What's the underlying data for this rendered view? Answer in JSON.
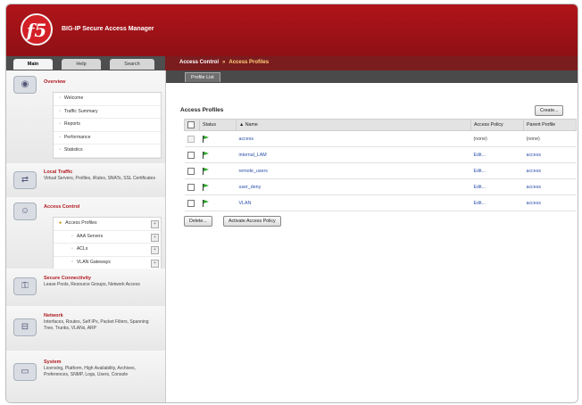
{
  "app": {
    "title": "BIG-IP Secure Access Manager",
    "logo_text": "f5"
  },
  "left_tabs": [
    "Main",
    "Help",
    "Search"
  ],
  "breadcrumb": {
    "section": "Access Control",
    "separator": "»",
    "current": "Access Profiles"
  },
  "subtab": "Profile List",
  "sidebar": {
    "overview": {
      "title": "Overview",
      "items": [
        "Welcome",
        "Traffic Summary",
        "Reports",
        "Performance",
        "Statistics"
      ]
    },
    "local_traffic": {
      "title": "Local Traffic",
      "desc": "Virtual Servers, Profiles, iRules, SNATs, SSL Certificates"
    },
    "access_control": {
      "title": "Access Control",
      "items": [
        "Access Profiles",
        "AAA Servers",
        "ACLs",
        "VLAN Gateways"
      ]
    },
    "secure_connectivity": {
      "title": "Secure Connectivity",
      "desc": "Lease Pools, Resource Groups, Network Access"
    },
    "network": {
      "title": "Network",
      "desc": "Interfaces, Routes, Self IPs, Packet Filters, Spanning Tree, Trunks, VLANs, ARP"
    },
    "system": {
      "title": "System",
      "desc": "Licensing, Platform, High Availability, Archives, Preferences, SNMP, Logs, Users, Console"
    }
  },
  "main": {
    "title": "Access Profiles",
    "create_label": "Create...",
    "columns": [
      "",
      "Status",
      "▲ Name",
      "Access Policy",
      "Parent Profile"
    ],
    "rows": [
      {
        "name": "access",
        "policy": "(none)",
        "parent": "(none)",
        "checkbox_enabled": false
      },
      {
        "name": "internal_LAM",
        "policy": "Edit...",
        "parent": "access",
        "checkbox_enabled": true
      },
      {
        "name": "remote_users",
        "policy": "Edit...",
        "parent": "access",
        "checkbox_enabled": true
      },
      {
        "name": "user_deny",
        "policy": "Edit...",
        "parent": "access",
        "checkbox_enabled": true
      },
      {
        "name": "VLAN",
        "policy": "Edit...",
        "parent": "access",
        "checkbox_enabled": true
      }
    ],
    "delete_label": "Delete...",
    "activate_label": "Activate Access Policy"
  },
  "colors": {
    "header_red": "#b0141a",
    "link_blue": "#2a4fa8",
    "status_green": "#2aa52a",
    "accent_yellow": "#ffd37a"
  }
}
